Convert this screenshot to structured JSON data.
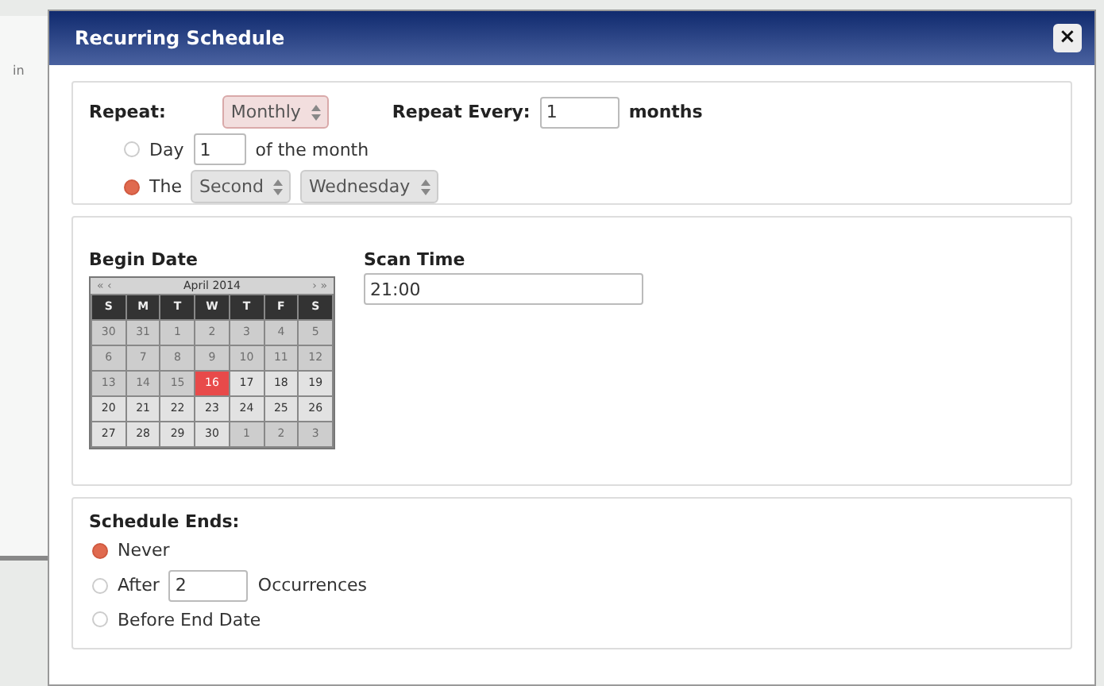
{
  "window": {
    "title": "Recurring Schedule",
    "close": "×"
  },
  "background": {
    "label": "in"
  },
  "repeat": {
    "label": "Repeat:",
    "value": "Monthly",
    "every_label": "Repeat Every:",
    "every_value": "1",
    "unit": "months"
  },
  "monthly_options": [
    {
      "kind": "day",
      "selected": false,
      "label": "Day",
      "value": "1",
      "suffix": "of the month"
    },
    {
      "kind": "weekday",
      "selected": true,
      "label": "The",
      "ordinal": "Second",
      "weekday": "Wednesday"
    }
  ],
  "begin_date": {
    "label": "Begin Date",
    "calendar": {
      "prev": "« ‹",
      "month": "April 2014",
      "next": "› »",
      "weekdays": [
        "S",
        "M",
        "T",
        "W",
        "T",
        "F",
        "S"
      ],
      "weeks": [
        [
          {
            "day": "30",
            "disabled": true,
            "selected": false
          },
          {
            "day": "31",
            "disabled": true,
            "selected": false
          },
          {
            "day": "1",
            "disabled": true,
            "selected": false
          },
          {
            "day": "2",
            "disabled": true,
            "selected": false
          },
          {
            "day": "3",
            "disabled": true,
            "selected": false
          },
          {
            "day": "4",
            "disabled": true,
            "selected": false
          },
          {
            "day": "5",
            "disabled": true,
            "selected": false
          }
        ],
        [
          {
            "day": "6",
            "disabled": true,
            "selected": false
          },
          {
            "day": "7",
            "disabled": true,
            "selected": false
          },
          {
            "day": "8",
            "disabled": true,
            "selected": false
          },
          {
            "day": "9",
            "disabled": true,
            "selected": false
          },
          {
            "day": "10",
            "disabled": true,
            "selected": false
          },
          {
            "day": "11",
            "disabled": true,
            "selected": false
          },
          {
            "day": "12",
            "disabled": true,
            "selected": false
          }
        ],
        [
          {
            "day": "13",
            "disabled": true,
            "selected": false
          },
          {
            "day": "14",
            "disabled": true,
            "selected": false
          },
          {
            "day": "15",
            "disabled": true,
            "selected": false
          },
          {
            "day": "16",
            "disabled": false,
            "selected": true
          },
          {
            "day": "17",
            "disabled": false,
            "selected": false
          },
          {
            "day": "18",
            "disabled": false,
            "selected": false
          },
          {
            "day": "19",
            "disabled": false,
            "selected": false
          }
        ],
        [
          {
            "day": "20",
            "disabled": false,
            "selected": false
          },
          {
            "day": "21",
            "disabled": false,
            "selected": false
          },
          {
            "day": "22",
            "disabled": false,
            "selected": false
          },
          {
            "day": "23",
            "disabled": false,
            "selected": false
          },
          {
            "day": "24",
            "disabled": false,
            "selected": false
          },
          {
            "day": "25",
            "disabled": false,
            "selected": false
          },
          {
            "day": "26",
            "disabled": false,
            "selected": false
          }
        ],
        [
          {
            "day": "27",
            "disabled": false,
            "selected": false
          },
          {
            "day": "28",
            "disabled": false,
            "selected": false
          },
          {
            "day": "29",
            "disabled": false,
            "selected": false
          },
          {
            "day": "30",
            "disabled": false,
            "selected": false
          },
          {
            "day": "1",
            "disabled": true,
            "selected": false
          },
          {
            "day": "2",
            "disabled": true,
            "selected": false
          },
          {
            "day": "3",
            "disabled": true,
            "selected": false
          }
        ]
      ]
    }
  },
  "scan_time": {
    "label": "Scan Time",
    "value": "21:00"
  },
  "schedule_ends": {
    "label": "Schedule Ends:",
    "options": [
      {
        "kind": "plain",
        "selected": true,
        "label": "Never"
      },
      {
        "kind": "count",
        "selected": false,
        "label": "After",
        "value": "2",
        "suffix": "Occurrences"
      },
      {
        "kind": "plain",
        "selected": false,
        "label": "Before End Date"
      }
    ]
  }
}
